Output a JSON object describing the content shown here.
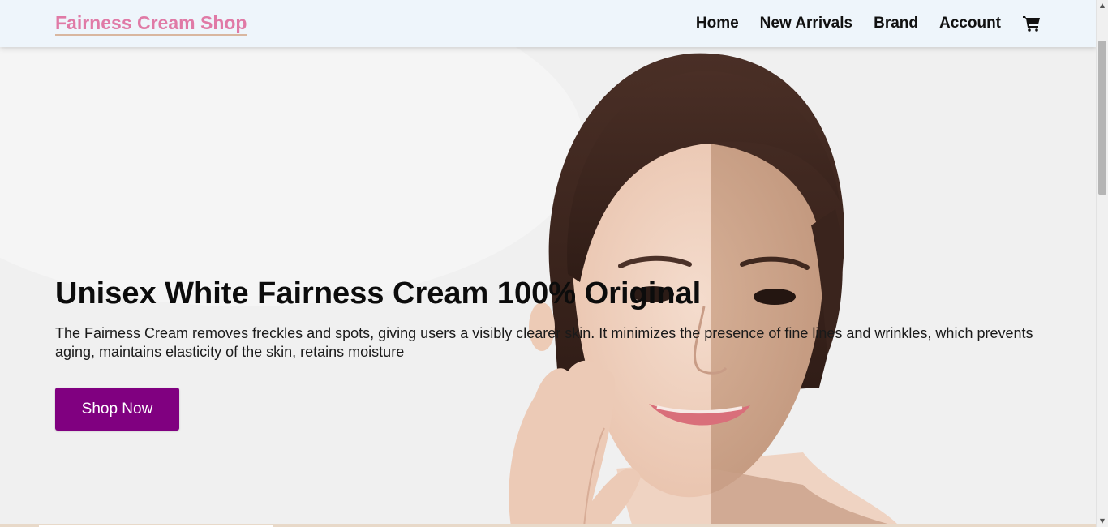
{
  "navbar": {
    "brand": "Fairness Cream Shop",
    "links": [
      {
        "label": "Home"
      },
      {
        "label": "New Arrivals"
      },
      {
        "label": "Brand"
      },
      {
        "label": "Account"
      }
    ],
    "cart_icon": "shopping-cart-icon"
  },
  "hero": {
    "title": "Unisex White Fairness Cream 100% Original",
    "description": "The Fairness Cream removes freckles and spots, giving users a visibly clearer skin. It minimizes the presence of fine lines and wrinkles, which prevents aging, maintains elasticity of the skin, retains moisture",
    "cta_label": "Shop Now",
    "image": "woman-half-face-comparison-photo"
  },
  "colors": {
    "brand": "#e07aa6",
    "navbar_bg": "#eef5fb",
    "cta_bg": "#800080",
    "cta_text": "#ffffff"
  }
}
